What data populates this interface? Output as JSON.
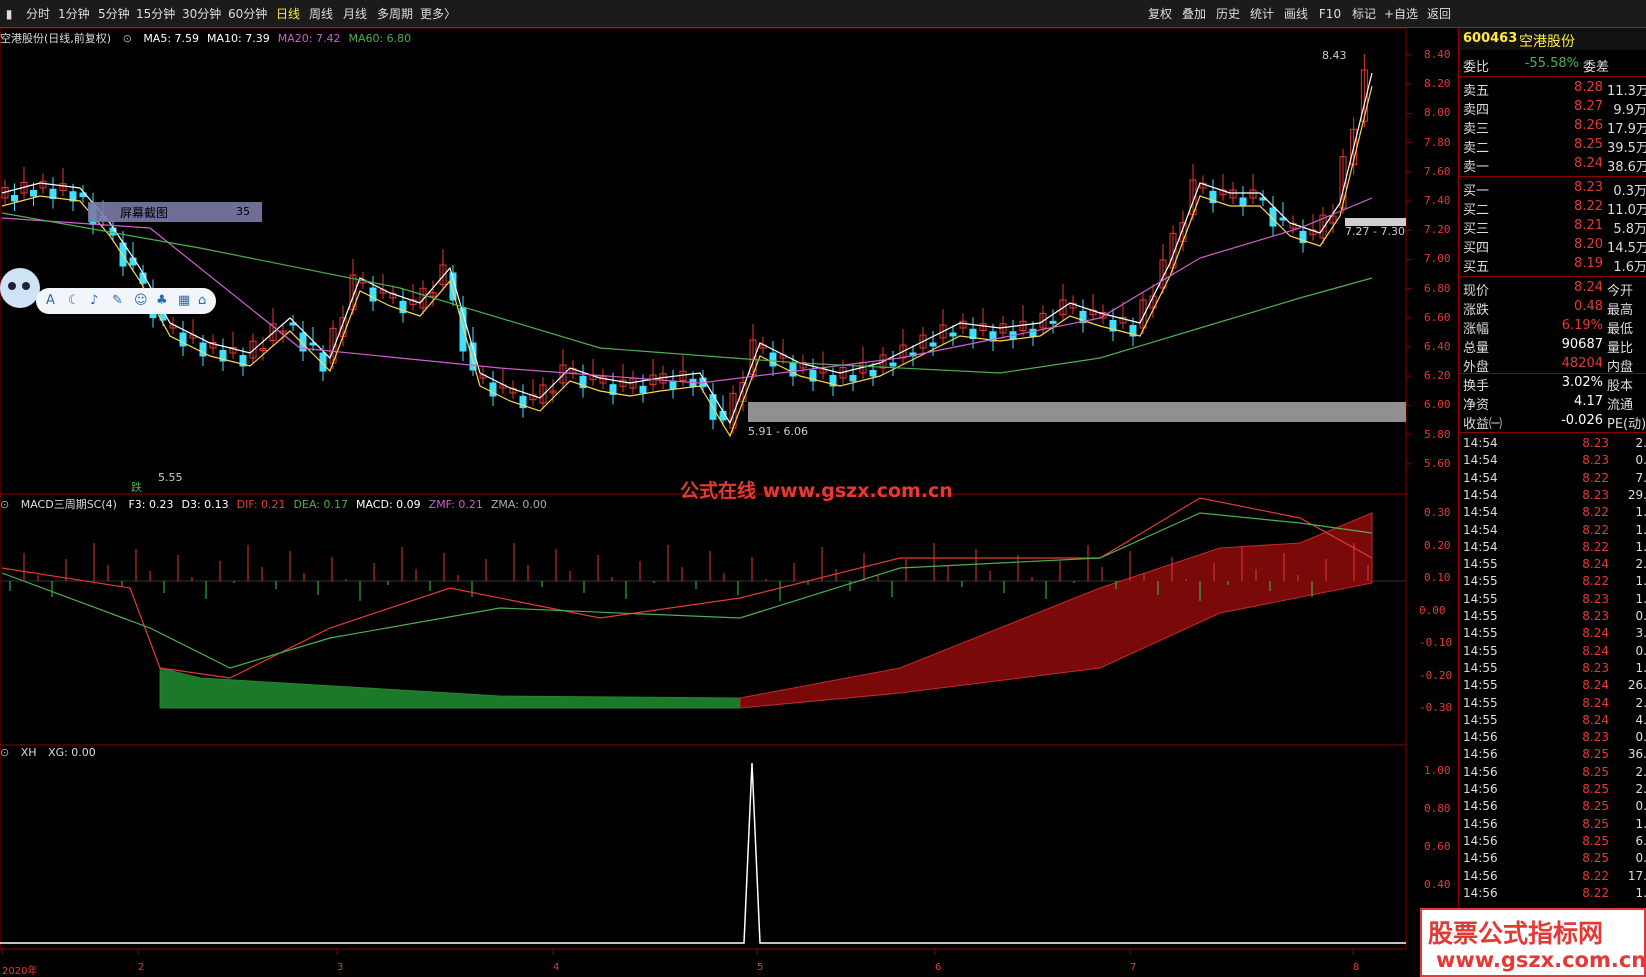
{
  "toolbar": {
    "periods": [
      "分时",
      "1分钟",
      "5分钟",
      "15分钟",
      "30分钟",
      "60分钟",
      "日线",
      "周线",
      "月线",
      "多周期",
      "更多〉"
    ],
    "active_period": "日线",
    "tools": [
      "复权",
      "叠加",
      "历史",
      "统计",
      "画线",
      "F10",
      "标记",
      "+自选",
      "返回"
    ]
  },
  "stock": {
    "code": "600463",
    "name": "空港股份"
  },
  "main_chart": {
    "title": "空港股份(日线,前复权)",
    "ma": [
      {
        "label": "MA5: 7.59",
        "color": "#ffffff"
      },
      {
        "label": "MA10: 7.39",
        "color": "#ffffff"
      },
      {
        "label": "MA20: 7.42",
        "color": "#d05fd0"
      },
      {
        "label": "MA60: 6.80",
        "color": "#4caf50"
      }
    ],
    "price_ticks": [
      "8.40",
      "8.20",
      "8.00",
      "7.80",
      "7.60",
      "7.40",
      "7.20",
      "7.00",
      "6.80",
      "6.60",
      "6.40",
      "6.20",
      "6.00",
      "5.80",
      "5.60"
    ],
    "high_label": "8.43",
    "low_label": "5.55",
    "zone_upper_label": "7.27 - 7.30",
    "zone_lower_label": "5.91 - 6.06",
    "fall_marker": "跌",
    "screenshot_label": "屏幕截图",
    "screenshot_count": "35",
    "watermark": "公式在线  www.gszx.com.cn"
  },
  "macd_panel": {
    "title": "MACD三周期SC(4)",
    "values": [
      {
        "label": "F3: 0.23",
        "color": "#ffffff"
      },
      {
        "label": "D3: 0.13",
        "color": "#ffffff"
      },
      {
        "label": "DIF: 0.21",
        "color": "#e53935"
      },
      {
        "label": "DEA: 0.17",
        "color": "#4caf50"
      },
      {
        "label": "MACD: 0.09",
        "color": "#ffffff"
      },
      {
        "label": "ZMF: 0.21",
        "color": "#d05fd0"
      },
      {
        "label": "ZMA: 0.00",
        "color": "#aaaaaa"
      }
    ],
    "ticks": [
      "0.30",
      "0.20",
      "0.10",
      "0.00",
      "-0.10",
      "-0.20",
      "-0.30"
    ]
  },
  "xh_panel": {
    "title": "XH",
    "value": "XG: 0.00",
    "ticks": [
      "1.00",
      "0.80",
      "0.60",
      "0.40"
    ]
  },
  "date_axis": {
    "labels": [
      "2020年",
      "2",
      "3",
      "4",
      "5",
      "6",
      "7",
      "8"
    ]
  },
  "quote": {
    "ratio_label": "委比",
    "ratio": "-55.58%",
    "diff_label": "委差",
    "asks": [
      {
        "label": "卖五",
        "price": "8.28",
        "vol": "11.3万"
      },
      {
        "label": "卖四",
        "price": "8.27",
        "vol": "9.9万"
      },
      {
        "label": "卖三",
        "price": "8.26",
        "vol": "17.9万"
      },
      {
        "label": "卖二",
        "price": "8.25",
        "vol": "39.5万"
      },
      {
        "label": "卖一",
        "price": "8.24",
        "vol": "38.6万"
      }
    ],
    "bids": [
      {
        "label": "买一",
        "price": "8.23",
        "vol": "0.3万"
      },
      {
        "label": "买二",
        "price": "8.22",
        "vol": "11.0万"
      },
      {
        "label": "买三",
        "price": "8.21",
        "vol": "5.8万"
      },
      {
        "label": "买四",
        "price": "8.20",
        "vol": "14.5万"
      },
      {
        "label": "买五",
        "price": "8.19",
        "vol": "1.6万"
      }
    ],
    "stats": [
      {
        "label": "现价",
        "value": "8.24",
        "right": "今开",
        "color": "#e53935"
      },
      {
        "label": "涨跌",
        "value": "0.48",
        "right": "最高",
        "color": "#e53935"
      },
      {
        "label": "涨幅",
        "value": "6.19%",
        "right": "最低",
        "color": "#e53935"
      },
      {
        "label": "总量",
        "value": "90687",
        "right": "量比",
        "color": "#ffffff"
      },
      {
        "label": "外盘",
        "value": "48204",
        "right": "内盘",
        "color": "#e53935"
      },
      {
        "label": "换手",
        "value": "3.02%",
        "right": "股本",
        "color": "#ffffff"
      },
      {
        "label": "净资",
        "value": "4.17",
        "right": "流通",
        "color": "#ffffff"
      },
      {
        "label": "收益㈠",
        "value": "-0.026",
        "right": "PE(动)",
        "color": "#ffffff"
      }
    ],
    "ticks": [
      {
        "time": "14:54",
        "price": "8.23",
        "vol": "2."
      },
      {
        "time": "14:54",
        "price": "8.23",
        "vol": "0."
      },
      {
        "time": "14:54",
        "price": "8.22",
        "vol": "7."
      },
      {
        "time": "14:54",
        "price": "8.23",
        "vol": "29."
      },
      {
        "time": "14:54",
        "price": "8.22",
        "vol": "1."
      },
      {
        "time": "14:54",
        "price": "8.22",
        "vol": "1."
      },
      {
        "time": "14:54",
        "price": "8.22",
        "vol": "1."
      },
      {
        "time": "14:55",
        "price": "8.24",
        "vol": "2."
      },
      {
        "time": "14:55",
        "price": "8.22",
        "vol": "1."
      },
      {
        "time": "14:55",
        "price": "8.23",
        "vol": "1."
      },
      {
        "time": "14:55",
        "price": "8.23",
        "vol": "0."
      },
      {
        "time": "14:55",
        "price": "8.24",
        "vol": "3."
      },
      {
        "time": "14:55",
        "price": "8.24",
        "vol": "0."
      },
      {
        "time": "14:55",
        "price": "8.23",
        "vol": "1."
      },
      {
        "time": "14:55",
        "price": "8.24",
        "vol": "26."
      },
      {
        "time": "14:55",
        "price": "8.24",
        "vol": "2."
      },
      {
        "time": "14:55",
        "price": "8.24",
        "vol": "4."
      },
      {
        "time": "14:56",
        "price": "8.23",
        "vol": "0."
      },
      {
        "time": "14:56",
        "price": "8.25",
        "vol": "36."
      },
      {
        "time": "14:56",
        "price": "8.25",
        "vol": "2."
      },
      {
        "time": "14:56",
        "price": "8.25",
        "vol": "2."
      },
      {
        "time": "14:56",
        "price": "8.25",
        "vol": "0."
      },
      {
        "time": "14:56",
        "price": "8.25",
        "vol": "1."
      },
      {
        "time": "14:56",
        "price": "8.25",
        "vol": "6."
      },
      {
        "time": "14:56",
        "price": "8.25",
        "vol": "0."
      },
      {
        "time": "14:56",
        "price": "8.22",
        "vol": "17."
      },
      {
        "time": "14:56",
        "price": "8.22",
        "vol": "1."
      }
    ]
  },
  "ad_banner": {
    "line1": "股票公式指标网",
    "line2": "www.gszx.com.cn"
  },
  "colors": {
    "up": "#e53935",
    "down": "#40e0ff",
    "ma60": "#4caf50",
    "ma20": "#d05fd0",
    "frame": "#8b0000"
  }
}
